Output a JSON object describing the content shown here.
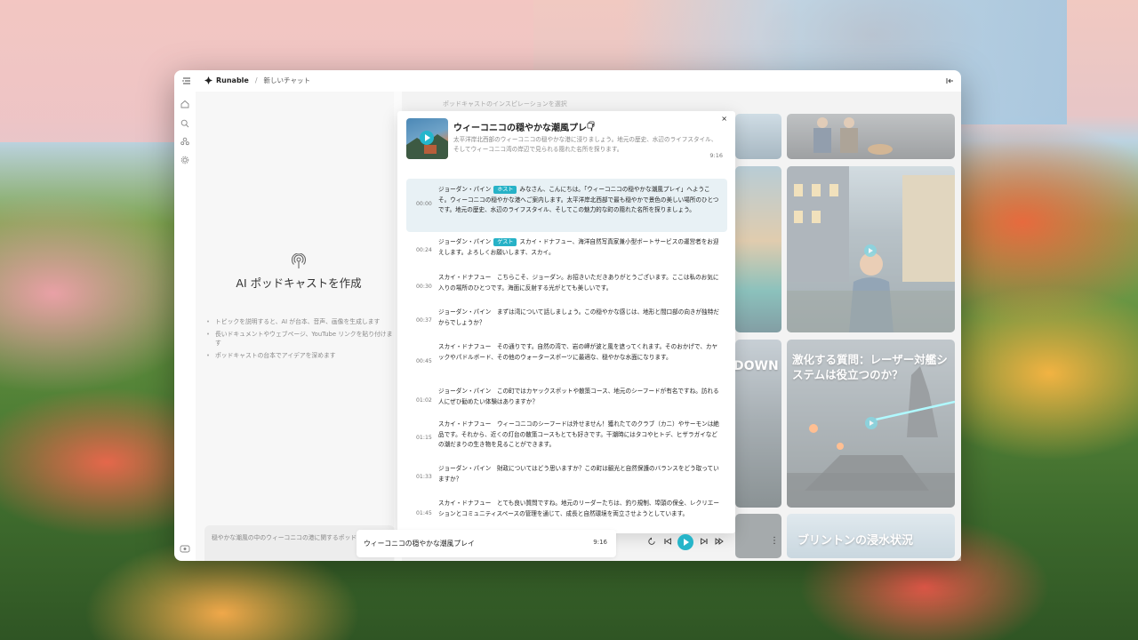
{
  "app": {
    "brand": "Runable",
    "breadcrumb_sep": "/",
    "breadcrumb": "新しいチャット"
  },
  "icons": {
    "menu": "sidebar-menu-icon",
    "home": "home-icon",
    "search": "search-icon",
    "people": "people-icon",
    "settings": "gear-icon",
    "collapse": "collapse-panel-icon"
  },
  "left_panel": {
    "title": "AI ポッドキャストを作成",
    "tips": [
      "トピックを説明すると、AI が台本、音声、画像を生成します",
      "長いドキュメントやウェブページ、YouTube リンクを貼り付けます",
      "ポッドキャストの台本でアイデアを深めます"
    ],
    "prompt_text": "穏やかな潮風の中のウィーコニコの港に関するポッドキャストを作成..."
  },
  "inspiration": {
    "header": "ポッドキャストのインスピレーションを選択",
    "tiles": [
      {
        "title": "激化する質問：レーザー対艦システムは役立つのか？"
      },
      {
        "title": "ブリントンの浸水状況"
      },
      {
        "title": "DOWN"
      }
    ]
  },
  "modal": {
    "close": "×",
    "title": "ウィーコニコの穏やかな潮風プレイ",
    "description": "太平洋岸北西部のウィーコニコの穏やかな港に浸りましょう。地元の歴史、水辺のライフスタイル、そしてウィーコニコ湾の岸辺で見られる隠れた名所を探ります。",
    "duration": "9:16",
    "transcript": [
      {
        "time": "00:00",
        "speaker": "ジョーダン・パイン",
        "badge": "ホスト",
        "text": "みなさん、こんにちは。「ウィーコニコの穏やかな潮風プレイ」へようこそ。ウィーコニコの穏やかな港へご案内します。太平洋岸北西部で最も穏やかで景色の美しい場所のひとつです。地元の歴史、水辺のライフスタイル、そしてこの魅力的な町の隠れた名所を探りましょう。",
        "active": true
      },
      {
        "time": "00:24",
        "speaker": "ジョーダン・パイン",
        "badge": "ゲスト",
        "text": "スカイ・ドナフュー、海洋自然写真家兼小型ボートサービスの運営者をお迎えします。よろしくお願いします、スカイ。"
      },
      {
        "time": "00:30",
        "speaker": "スカイ・ドナフュー",
        "badge": "",
        "text": "こちらこそ、ジョーダン。お招きいただきありがとうございます。ここは私のお気に入りの場所のひとつです。海面に反射する光がとても美しいです。"
      },
      {
        "time": "00:37",
        "speaker": "ジョーダン・パイン",
        "badge": "",
        "text": "まずは湾について話しましょう。この穏やかな感じは、地形と間口部の向きが独特だからでしょうか？"
      },
      {
        "time": "00:45",
        "speaker": "スカイ・ドナフュー",
        "badge": "",
        "text": "その通りです。自然の湾で、岩の岬が波と風を遮ってくれます。そのおかげで、カヤックやパドルボード、その他のウォータースポーツに最適な、穏やかな水面になります。"
      },
      {
        "time": "01:02",
        "speaker": "ジョーダン・パイン",
        "badge": "",
        "text": "この町ではカヤックスポットや散策コース、地元のシーフードが有名ですね。訪れる人にぜひ勧めたい体験はありますか？"
      },
      {
        "time": "01:15",
        "speaker": "スカイ・ドナフュー",
        "badge": "",
        "text": "ウィーコニコのシーフードは外せません！獲れたてのクラブ（カニ）やサーモンは絶品です。それから、近くの灯台の散策コースもとても好きです。干潮時にはタコやヒトデ、ヒザラガイなどの潮だまりの生き物を見ることができます。"
      },
      {
        "time": "01:33",
        "speaker": "ジョーダン・パイン",
        "badge": "",
        "text": "財政についてはどう思いますか？この町は観光と自然保護のバランスをどう取っていますか？"
      },
      {
        "time": "01:45",
        "speaker": "スカイ・ドナフュー",
        "badge": "",
        "text": "とても良い質問ですね。地元のリーダーたちは、釣り規制、埠頭の保全、レクリエーションとコミュニティスペースの管理を通じて、成長と自然環境を両立させようとしています。"
      }
    ]
  },
  "player": {
    "title": "ウィーコニコの穏やかな潮風プレイ",
    "duration": "9:16",
    "more": "⋮"
  },
  "colors": {
    "accent": "#26b5c9"
  }
}
